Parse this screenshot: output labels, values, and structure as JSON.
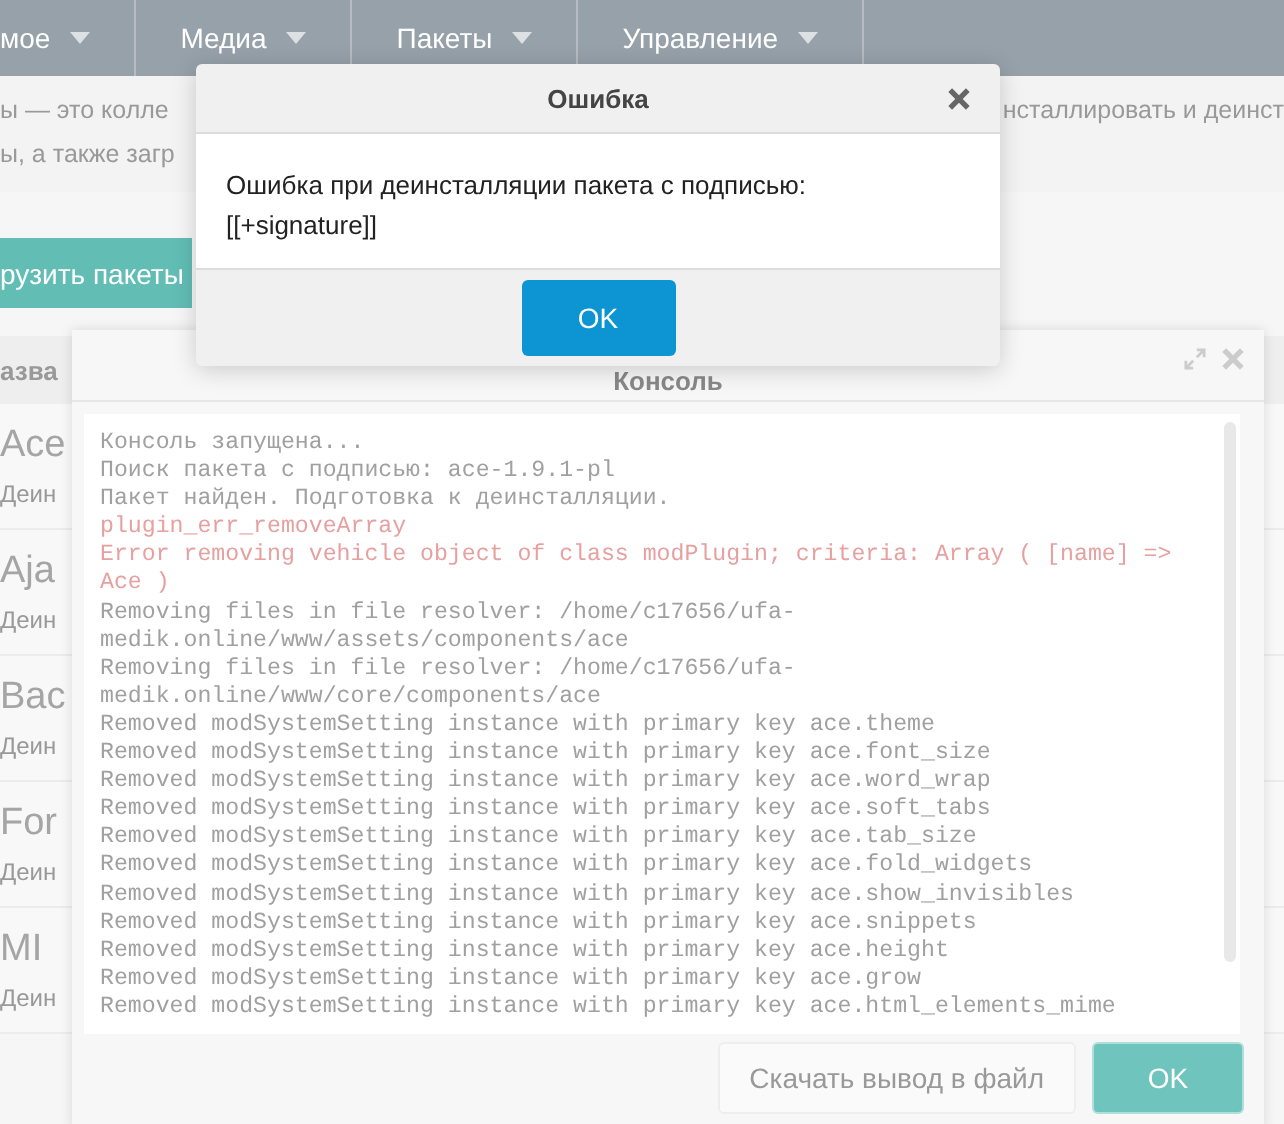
{
  "nav": {
    "items": [
      {
        "label": "мое"
      },
      {
        "label": "Медиа"
      },
      {
        "label": "Пакеты"
      },
      {
        "label": "Управление"
      }
    ]
  },
  "page": {
    "description": {
      "line_1_left": "ы — это колле",
      "line_1_right": "нсталлировать и деинст",
      "line_2": "ы, а также загр"
    },
    "upload_button": "рузить пакеты",
    "grid": {
      "column_header": "азва",
      "rows": [
        {
          "name": "Ace",
          "action": "Деин"
        },
        {
          "name": "Aja",
          "action": "Деин"
        },
        {
          "name": "Bac",
          "action": "Деин"
        },
        {
          "name": "For",
          "action": "Деин"
        },
        {
          "name": "MI",
          "action": "Деин"
        }
      ]
    }
  },
  "console": {
    "title": "Консоль",
    "lines": [
      {
        "kind": "info",
        "text": "Консоль запущена..."
      },
      {
        "kind": "info",
        "text": "Поиск пакета с подписью: ace-1.9.1-pl"
      },
      {
        "kind": "info",
        "text": "Пакет найден. Подготовка к деинсталляции."
      },
      {
        "kind": "error",
        "text": "plugin_err_removeArray"
      },
      {
        "kind": "error",
        "text": "Error removing vehicle object of class modPlugin; criteria: Array ( [name] => Ace )"
      },
      {
        "kind": "info",
        "text": "Removing files in file resolver: /home/c17656/ufa-medik.online/www/assets/components/ace"
      },
      {
        "kind": "info",
        "text": "Removing files in file resolver: /home/c17656/ufa-medik.online/www/core/components/ace"
      },
      {
        "kind": "info",
        "text": "Removed modSystemSetting instance with primary key ace.theme"
      },
      {
        "kind": "info",
        "text": "Removed modSystemSetting instance with primary key ace.font_size"
      },
      {
        "kind": "info",
        "text": "Removed modSystemSetting instance with primary key ace.word_wrap"
      },
      {
        "kind": "info",
        "text": "Removed modSystemSetting instance with primary key ace.soft_tabs"
      },
      {
        "kind": "info",
        "text": "Removed modSystemSetting instance with primary key ace.tab_size"
      },
      {
        "kind": "info",
        "text": "Removed modSystemSetting instance with primary key ace.fold_widgets"
      },
      {
        "kind": "info",
        "text": "Removed modSystemSetting instance with primary key ace.show_invisibles"
      },
      {
        "kind": "info",
        "text": "Removed modSystemSetting instance with primary key ace.snippets"
      },
      {
        "kind": "info",
        "text": "Removed modSystemSetting instance with primary key ace.height"
      },
      {
        "kind": "info",
        "text": "Removed modSystemSetting instance with primary key ace.grow"
      },
      {
        "kind": "info",
        "text": "Removed modSystemSetting instance with primary key ace.html_elements_mime"
      }
    ],
    "buttons": [
      {
        "label": "Скачать вывод в файл",
        "kind": "secondary",
        "disabled": false
      },
      {
        "label": "OK",
        "kind": "primary",
        "disabled": true
      }
    ]
  },
  "dialog": {
    "title": "Ошибка",
    "message": "Ошибка при деинсталляции пакета с подписью: [[+signature]]",
    "button": "OK"
  }
}
